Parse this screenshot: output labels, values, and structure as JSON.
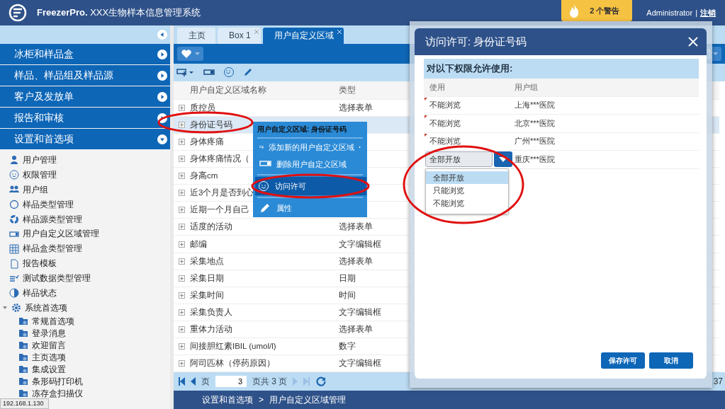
{
  "header": {
    "brand": "FreezerPro.",
    "title": "XXX生物样本信息管理系统",
    "alert": "2 个警告",
    "user": "Administrator",
    "separator": "|",
    "logout": "注销"
  },
  "sidebar": {
    "sections": [
      {
        "label": "冰柜和样品盒",
        "expanded": false
      },
      {
        "label": "样品、样品组及样品源",
        "expanded": false
      },
      {
        "label": "客户及发放单",
        "expanded": false
      },
      {
        "label": "报告和审核",
        "expanded": false
      },
      {
        "label": "设置和首选项",
        "expanded": true
      }
    ],
    "items": [
      {
        "label": "用户管理",
        "kind": "user"
      },
      {
        "label": "权限管理",
        "kind": "smile"
      },
      {
        "label": "用户组",
        "kind": "group"
      },
      {
        "label": "样品类型管理",
        "kind": "circle"
      },
      {
        "label": "样品源类型管理",
        "kind": "ring"
      },
      {
        "label": "用户自定义区域管理",
        "kind": "field"
      },
      {
        "label": "样品盒类型管理",
        "kind": "grid"
      },
      {
        "label": "报告模板",
        "kind": "doc"
      },
      {
        "label": "测试数据类型管理",
        "kind": "list"
      },
      {
        "label": "样品状态",
        "kind": "pie"
      },
      {
        "label": "系统首选项",
        "kind": "gear",
        "expanded": true,
        "children": [
          {
            "label": "常规首选项",
            "kind": "folder"
          },
          {
            "label": "登录消息",
            "kind": "folder"
          },
          {
            "label": "欢迎留言",
            "kind": "folder"
          },
          {
            "label": "主页选项",
            "kind": "folder"
          },
          {
            "label": "集成设置",
            "kind": "folder"
          },
          {
            "label": "条形码打印机",
            "kind": "folder"
          },
          {
            "label": "冻存盒扫描仪",
            "kind": "folder"
          }
        ]
      }
    ]
  },
  "status_url": "192.168.1.130",
  "tabs": [
    {
      "label": "主页",
      "selected": false,
      "closable": false
    },
    {
      "label": "Box 1",
      "selected": false,
      "closable": true
    },
    {
      "label": "用户自定义区域",
      "selected": true,
      "closable": true
    }
  ],
  "table": {
    "columns": [
      "用户自定义区域名称",
      "类型"
    ],
    "rows": [
      {
        "name": "质控员",
        "type": "选择表单",
        "selected": false
      },
      {
        "name": "身份证号码",
        "selected": true
      },
      {
        "name": "身体疼痛",
        "selected": false
      },
      {
        "name": "身体疼痛情况（",
        "selected": false
      },
      {
        "name": "身高cm",
        "selected": false
      },
      {
        "name": "近3个月是否到心",
        "selected": false
      },
      {
        "name": "近期一个月自己",
        "selected": false
      },
      {
        "name": "适度的活动",
        "type": "选择表单",
        "selected": false
      },
      {
        "name": "邮编",
        "type": "文字编辑框",
        "selected": false
      },
      {
        "name": "采集地点",
        "type": "选择表单",
        "selected": false
      },
      {
        "name": "采集日期",
        "type": "日期",
        "selected": false
      },
      {
        "name": "采集时间",
        "type": "时间",
        "selected": false
      },
      {
        "name": "采集负责人",
        "type": "文字编辑框",
        "selected": false
      },
      {
        "name": "重体力活动",
        "type": "选择表单",
        "selected": false
      },
      {
        "name": "间接胆红素IBIL (umol/l)",
        "type": "数字",
        "selected": false
      },
      {
        "name": "阿司匹林（停药原因）",
        "type": "文字编辑框",
        "selected": false
      }
    ]
  },
  "pager": {
    "page_label": "页",
    "page": "3",
    "total": "页共 3 页",
    "right_fragment": "37"
  },
  "breadcrumb": {
    "items": [
      "设置和首选项",
      "用户自定义区域管理"
    ],
    "separator": ">"
  },
  "context_menu": {
    "title": "用户自定义区域: 身份证号码",
    "items": [
      {
        "label": "添加新的用户自定义区域",
        "kind": "add",
        "submenu": true,
        "selected": false
      },
      {
        "label": "删除用户自定义区域",
        "kind": "remove",
        "submenu": false,
        "selected": false
      },
      {
        "label": "访问许可",
        "kind": "permission",
        "submenu": false,
        "selected": true
      },
      {
        "label": "属性",
        "kind": "edit",
        "submenu": false,
        "selected": false
      }
    ]
  },
  "dialog": {
    "title": "访问许可: 身份证号码",
    "section_title": "对以下权限允许使用:",
    "columns": [
      "使用",
      "用户组"
    ],
    "rows": [
      {
        "access": "不能浏览",
        "group": "上海***医院",
        "modified": true,
        "editing": false
      },
      {
        "access": "不能浏览",
        "group": "北京***医院",
        "modified": true,
        "editing": false
      },
      {
        "access": "不能浏览",
        "group": "广州***医院",
        "modified": true,
        "editing": false
      },
      {
        "access": "全部开放",
        "group": "重庆***医院",
        "modified": false,
        "editing": true
      }
    ],
    "options": [
      {
        "label": "全部开放",
        "selected": true
      },
      {
        "label": "只能浏览",
        "selected": false
      },
      {
        "label": "不能浏览",
        "selected": false
      }
    ],
    "buttons": [
      "保存许可",
      "取消"
    ]
  }
}
